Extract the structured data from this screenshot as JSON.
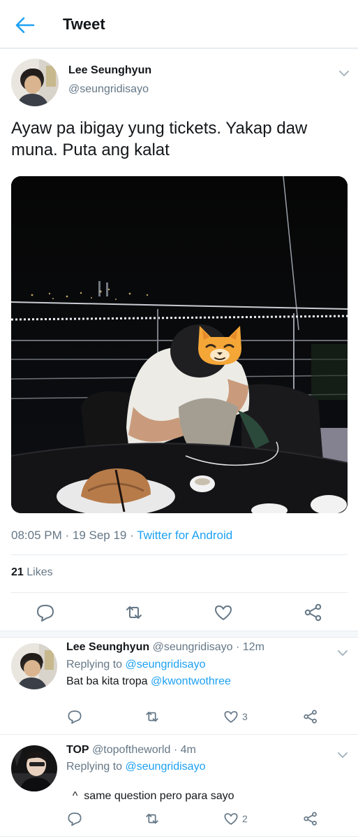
{
  "header": {
    "title": "Tweet"
  },
  "tweet": {
    "author_name": "Lee Seunghyun",
    "author_handle": "@seungridisayo",
    "text": "Ayaw pa ibigay yung tickets. Yakap daw muna. Puta ang kalat",
    "time": "08:05 PM",
    "date": "19 Sep 19",
    "source": "Twitter for Android",
    "likes_count": "21",
    "likes_label": "Likes"
  },
  "replies": [
    {
      "author_name": "Lee Seunghyun",
      "author_handle": "@seungridisayo",
      "age": "12m",
      "replying_label": "Replying to",
      "replying_to": "@seungridisayo",
      "text": "Bat ba kita tropa",
      "mention": "@kwontwothree",
      "like_count": "3"
    },
    {
      "author_name": "TOP",
      "author_handle": "@topoftheworld",
      "age": "4m",
      "replying_label": "Replying to",
      "replying_to": "@seungridisayo",
      "text": "^  same question pero para sayo",
      "like_count": "2"
    }
  ],
  "icons": {
    "back": "arrow-left-icon",
    "menu": "chevron-down-icon",
    "reply": "reply-icon",
    "retweet": "retweet-icon",
    "like": "heart-icon",
    "share": "share-icon",
    "sticker": "cat-face-icon"
  },
  "colors": {
    "accent": "#1da1f2",
    "text": "#14171a",
    "muted": "#657786",
    "border": "#e6ecf0"
  }
}
